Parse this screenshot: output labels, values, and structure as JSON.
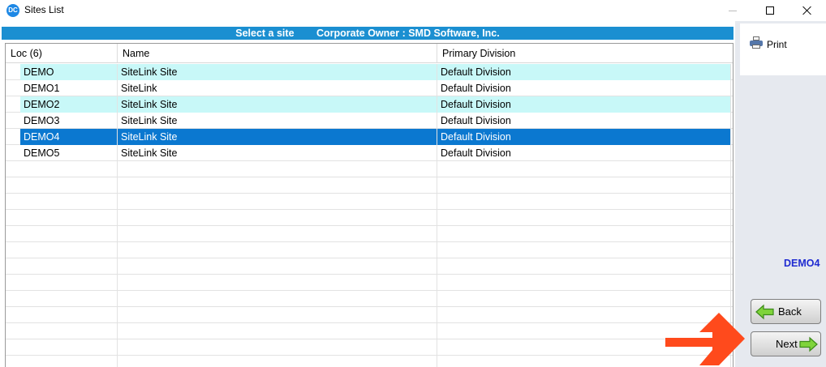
{
  "window": {
    "icon_text": "DC",
    "title": "Sites List"
  },
  "banner": {
    "left": "Select a site",
    "right": "Corporate Owner : SMD Software, Inc."
  },
  "grid": {
    "columns": [
      "Loc (6)",
      "Name",
      "Primary Division"
    ],
    "rows": [
      {
        "loc": "DEMO",
        "name": "SiteLink Site",
        "division": "Default Division"
      },
      {
        "loc": "DEMO1",
        "name": "SiteLink",
        "division": "Default Division"
      },
      {
        "loc": "DEMO2",
        "name": "SiteLink Site",
        "division": "Default Division"
      },
      {
        "loc": "DEMO3",
        "name": "SiteLink Site",
        "division": "Default Division"
      },
      {
        "loc": "DEMO4",
        "name": "SiteLink Site",
        "division": "Default Division"
      },
      {
        "loc": "DEMO5",
        "name": "SiteLink Site",
        "division": "Default Division"
      }
    ],
    "selected_loc": "DEMO4"
  },
  "side": {
    "print_label": "Print",
    "current_site": "DEMO4",
    "back_label": "Back",
    "next_label": "Next"
  },
  "colors": {
    "banner": "#1b8fd1",
    "alt_row": "#c8f8f8",
    "selected_row": "#0b78d0",
    "site_code": "#1f2bd1",
    "pointer": "#ff4a1c"
  },
  "icons": {
    "app": "dc-logo-icon",
    "print": "printer-icon",
    "back": "green-left-arrow-icon",
    "next": "green-right-arrow-icon"
  }
}
